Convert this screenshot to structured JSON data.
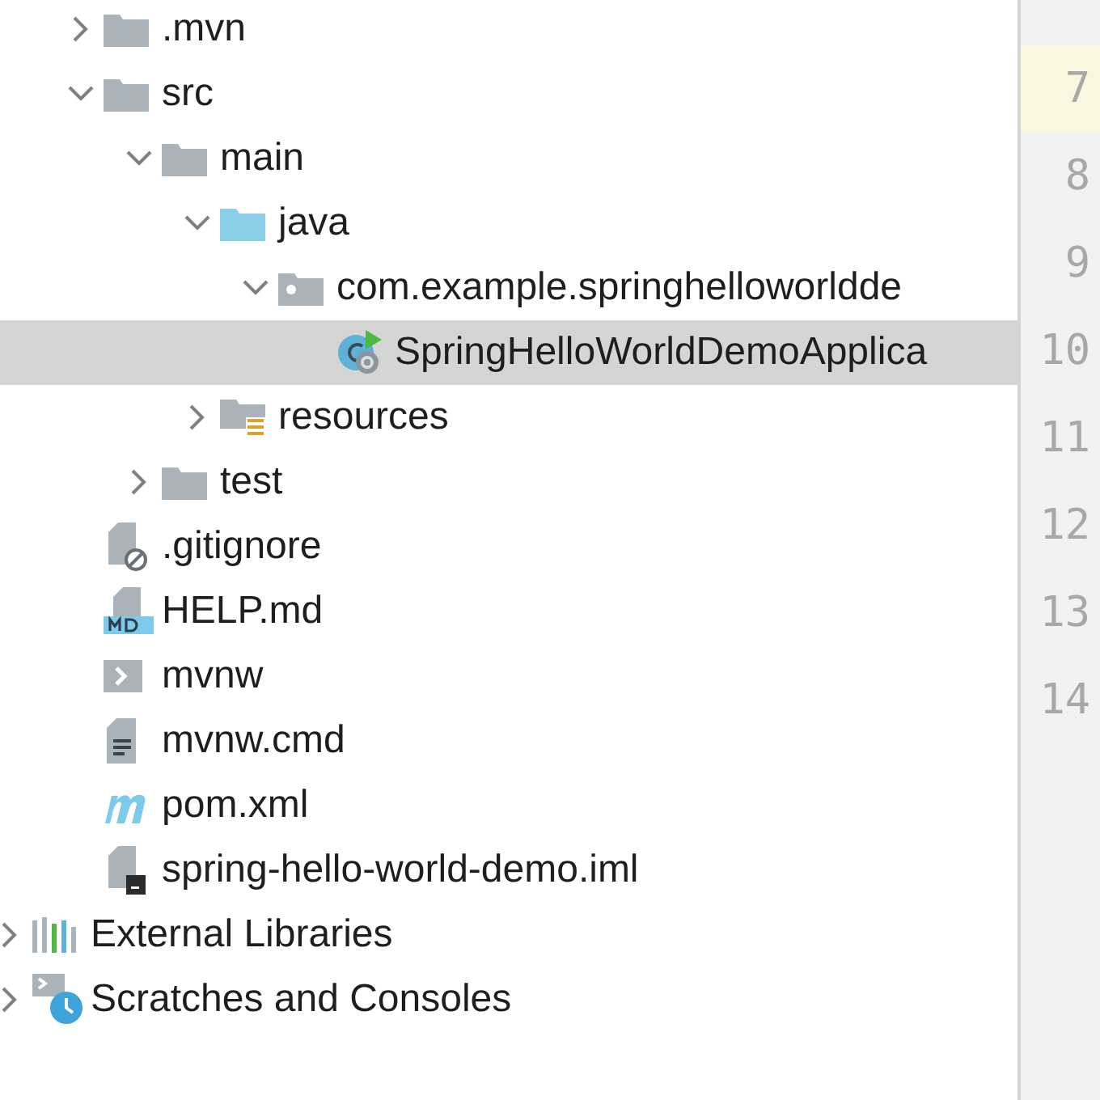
{
  "tree": [
    {
      "label": ".mvn",
      "kind": "folder",
      "expanded": false,
      "selected": false
    },
    {
      "label": "src",
      "kind": "folder",
      "expanded": true,
      "selected": false,
      "children": [
        {
          "label": "main",
          "kind": "folder",
          "expanded": true,
          "selected": false,
          "children": [
            {
              "label": "java",
              "kind": "source-folder",
              "expanded": true,
              "selected": false,
              "children": [
                {
                  "label": "com.example.springhelloworldde",
                  "kind": "package",
                  "expanded": true,
                  "selected": false,
                  "children": [
                    {
                      "label": "SpringHelloWorldDemoApplica",
                      "kind": "spring-class",
                      "selected": true
                    }
                  ]
                }
              ]
            },
            {
              "label": "resources",
              "kind": "resources-folder",
              "expanded": false,
              "selected": false
            }
          ]
        },
        {
          "label": "test",
          "kind": "folder",
          "expanded": false,
          "selected": false
        }
      ]
    },
    {
      "label": ".gitignore",
      "kind": "ignore-file",
      "selected": false
    },
    {
      "label": "HELP.md",
      "kind": "markdown",
      "selected": false
    },
    {
      "label": "mvnw",
      "kind": "shell",
      "selected": false
    },
    {
      "label": "mvnw.cmd",
      "kind": "text-file",
      "selected": false
    },
    {
      "label": "pom.xml",
      "kind": "maven",
      "selected": false
    },
    {
      "label": "spring-hello-world-demo.iml",
      "kind": "module-file",
      "selected": false
    }
  ],
  "root_items": [
    {
      "label": "External Libraries",
      "kind": "libraries",
      "expanded": false,
      "selected": false
    },
    {
      "label": "Scratches and Consoles",
      "kind": "scratches",
      "expanded": false,
      "selected": false
    }
  ],
  "gutter": [
    {
      "number": "7",
      "current": true
    },
    {
      "number": "8",
      "current": false
    },
    {
      "number": "9",
      "current": false
    },
    {
      "number": "10",
      "current": false
    },
    {
      "number": "11",
      "current": false
    },
    {
      "number": "12",
      "current": false
    },
    {
      "number": "13",
      "current": false
    },
    {
      "number": "14",
      "current": false
    }
  ]
}
